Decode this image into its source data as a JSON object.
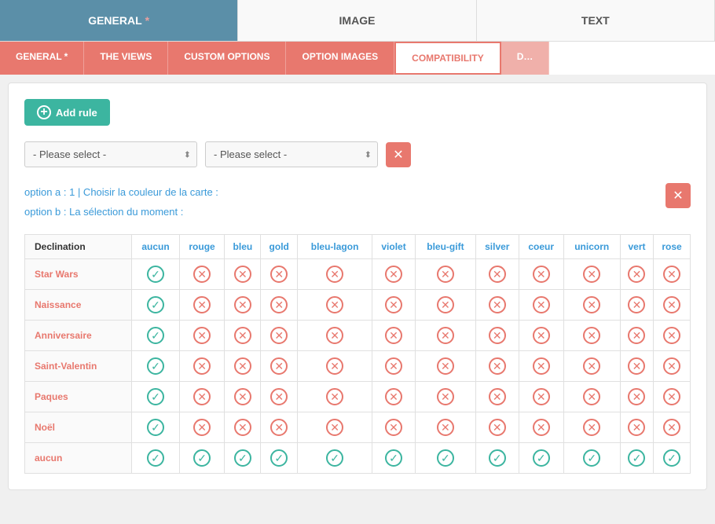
{
  "topTabs": [
    {
      "label": "GENERAL",
      "asterisk": true,
      "active": true
    },
    {
      "label": "IMAGE",
      "asterisk": false,
      "active": false
    },
    {
      "label": "TEXT",
      "asterisk": false,
      "active": false
    }
  ],
  "subTabs": [
    {
      "label": "GENERAL",
      "asterisk": true,
      "style": "normal"
    },
    {
      "label": "THE VIEWS",
      "asterisk": false,
      "style": "normal"
    },
    {
      "label": "CUSTOM OPTIONS",
      "asterisk": false,
      "style": "normal"
    },
    {
      "label": "OPTION IMAGES",
      "asterisk": false,
      "style": "normal"
    },
    {
      "label": "COMPATIBILITY",
      "asterisk": false,
      "style": "active"
    },
    {
      "label": "D…",
      "asterisk": false,
      "style": "dimmed"
    }
  ],
  "addRuleButton": "Add rule",
  "selects": {
    "first": {
      "placeholder": "- Please select -",
      "options": [
        "- Please select -"
      ]
    },
    "second": {
      "placeholder": "- Please select -",
      "options": [
        "- Please select -"
      ]
    }
  },
  "ruleInfo": {
    "lineA": "option a : 1  |  Choisir la couleur de la carte :",
    "lineB": "option b : La sélection du moment :"
  },
  "table": {
    "headers": [
      "Declination",
      "aucun",
      "rouge",
      "bleu",
      "gold",
      "bleu-lagon",
      "violet",
      "bleu-gift",
      "silver",
      "coeur",
      "unicorn",
      "vert",
      "rose"
    ],
    "rows": [
      {
        "label": "Star Wars",
        "values": [
          "check",
          "cross",
          "cross",
          "cross",
          "cross",
          "cross",
          "cross",
          "cross",
          "cross",
          "cross",
          "cross",
          "cross"
        ]
      },
      {
        "label": "Naissance",
        "values": [
          "check",
          "cross",
          "cross",
          "cross",
          "cross",
          "cross",
          "cross",
          "cross",
          "cross",
          "cross",
          "cross",
          "cross"
        ]
      },
      {
        "label": "Anniversaire",
        "values": [
          "check",
          "cross",
          "cross",
          "cross",
          "cross",
          "cross",
          "cross",
          "cross",
          "cross",
          "cross",
          "cross",
          "cross"
        ]
      },
      {
        "label": "Saint-Valentin",
        "values": [
          "check",
          "cross",
          "cross",
          "cross",
          "cross",
          "cross",
          "cross",
          "cross",
          "cross",
          "cross",
          "cross",
          "cross"
        ]
      },
      {
        "label": "Paques",
        "values": [
          "check",
          "cross",
          "cross",
          "cross",
          "cross",
          "cross",
          "cross",
          "cross",
          "cross",
          "cross",
          "cross",
          "cross"
        ]
      },
      {
        "label": "Noël",
        "values": [
          "check",
          "cross",
          "cross",
          "cross",
          "cross",
          "cross",
          "cross",
          "cross",
          "cross",
          "cross",
          "cross",
          "cross"
        ]
      },
      {
        "label": "aucun",
        "values": [
          "check",
          "check",
          "check",
          "check",
          "check",
          "check",
          "check",
          "check",
          "check",
          "check",
          "check",
          "check"
        ]
      }
    ]
  }
}
